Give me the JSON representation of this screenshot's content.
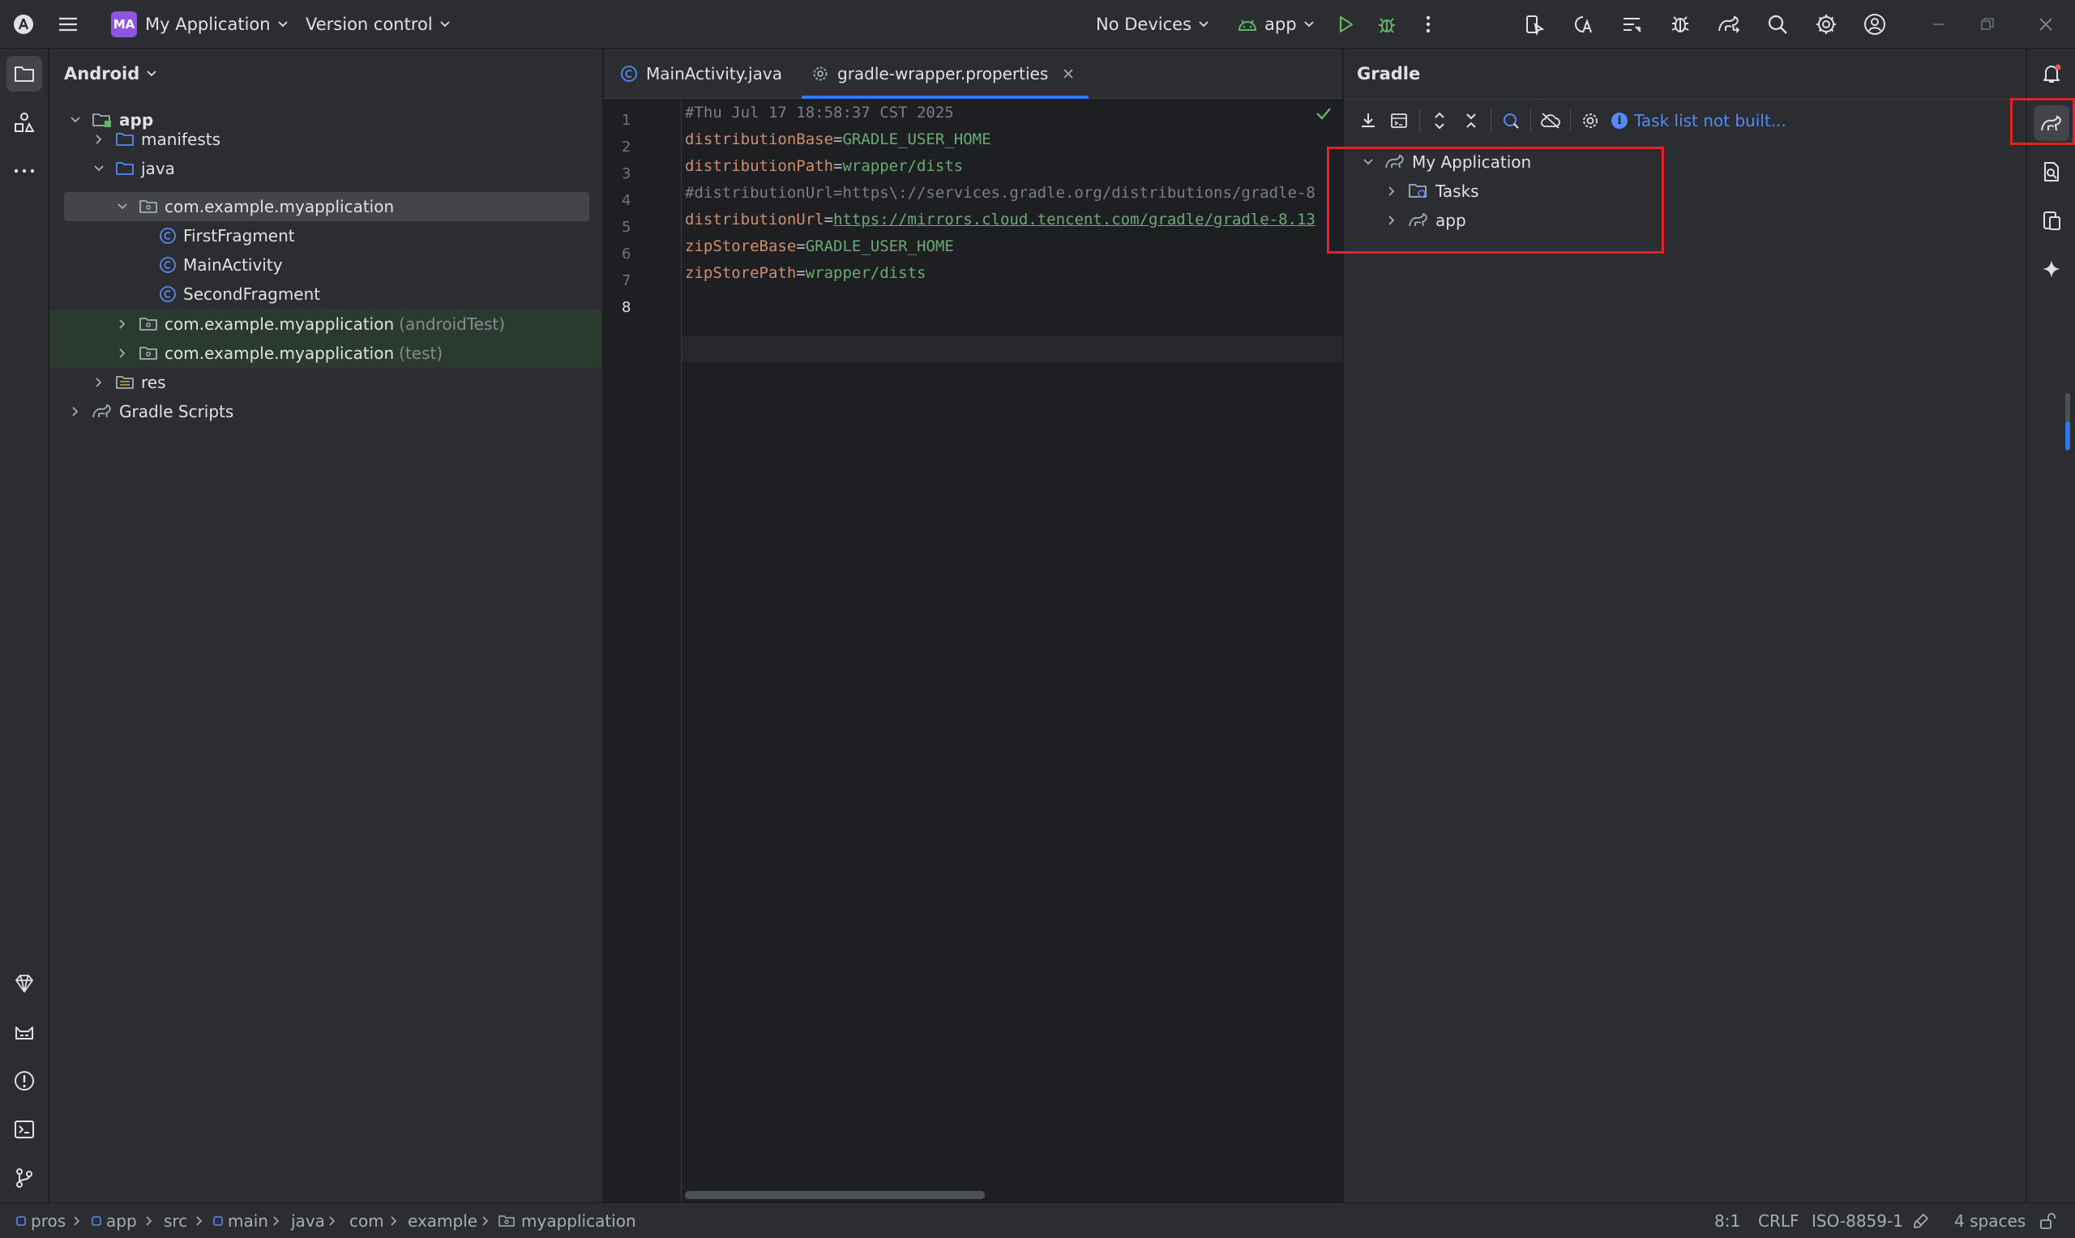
{
  "titlebar": {
    "project_badge": "MA",
    "project_name": "My Application",
    "vcs_label": "Version control",
    "device_label": "No Devices",
    "run_config": "app"
  },
  "project_panel": {
    "view_label": "Android",
    "tree": [
      {
        "label": "app"
      },
      {
        "label": "manifests"
      },
      {
        "label": "java"
      },
      {
        "label": "com.example.myapplication"
      },
      {
        "label": "FirstFragment"
      },
      {
        "label": "MainActivity"
      },
      {
        "label": "SecondFragment"
      },
      {
        "label": "com.example.myapplication",
        "suffix": "(androidTest)"
      },
      {
        "label": "com.example.myapplication",
        "suffix": "(test)"
      },
      {
        "label": "res"
      },
      {
        "label": "Gradle Scripts"
      }
    ]
  },
  "editor": {
    "tabs": [
      {
        "label": "MainActivity.java"
      },
      {
        "label": "gradle-wrapper.properties"
      }
    ],
    "line_numbers": [
      "1",
      "2",
      "3",
      "4",
      "5",
      "6",
      "7",
      "8"
    ],
    "lines": [
      {
        "text": "#Thu Jul 17 18:58:37 CST 2025"
      },
      {
        "key": "distributionBase",
        "eq": "=",
        "value": "GRADLE_USER_HOME"
      },
      {
        "key": "distributionPath",
        "eq": "=",
        "value": "wrapper/dists"
      },
      {
        "text": "#distributionUrl=https\\://services.gradle.org/distributions/gradle-8"
      },
      {
        "key": "distributionUrl",
        "eq": "=",
        "value": "https://mirrors.cloud.tencent.com/gradle/gradle-8.13"
      },
      {
        "key": "zipStoreBase",
        "eq": "=",
        "value": "GRADLE_USER_HOME"
      },
      {
        "key": "zipStorePath",
        "eq": "=",
        "value": "wrapper/dists"
      }
    ]
  },
  "gradle_panel": {
    "title": "Gradle",
    "task_list_link": "Task list not built...",
    "tree": [
      {
        "label": "My Application"
      },
      {
        "label": "Tasks"
      },
      {
        "label": "app"
      }
    ]
  },
  "statusbar": {
    "breadcrumbs": [
      "pros",
      "app",
      "src",
      "main",
      "java",
      "com",
      "example",
      "myapplication"
    ],
    "position": "8:1",
    "line_separator": "CRLF",
    "encoding": "ISO-8859-1",
    "indent": "4 spaces"
  },
  "colors": {
    "highlight": "#e02424",
    "accent": "#3574f0",
    "project_badge": "#8c56e0"
  }
}
